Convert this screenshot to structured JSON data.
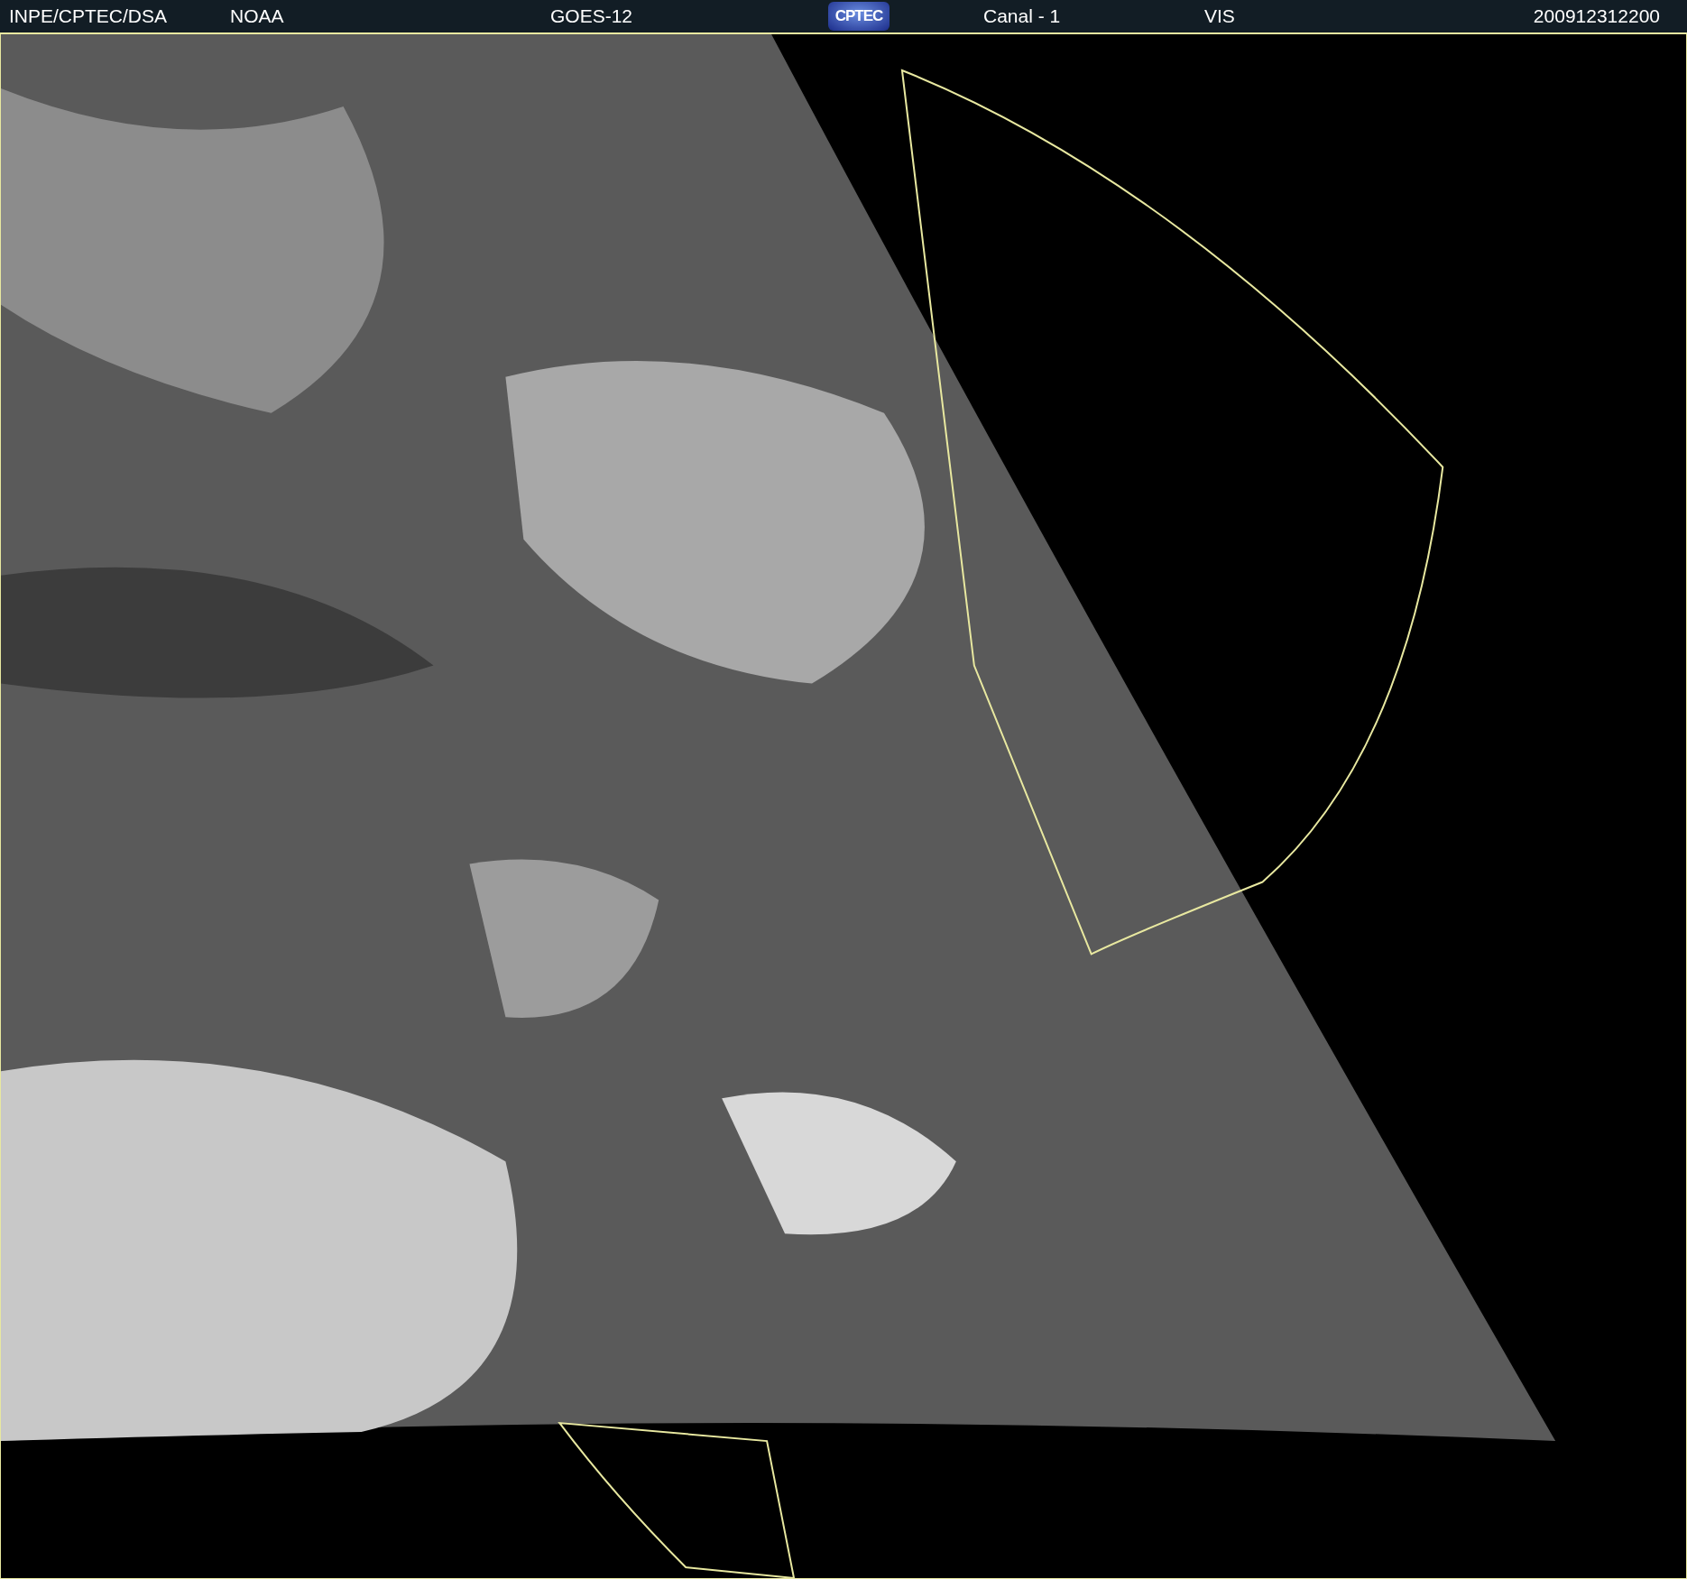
{
  "header": {
    "items": [
      {
        "kind": "text",
        "text": "INPE/CPTEC/DSA"
      },
      {
        "kind": "text",
        "text": "NOAA"
      },
      {
        "kind": "text",
        "text": "GOES-12"
      },
      {
        "kind": "logo",
        "text": "CPTEC"
      },
      {
        "kind": "text",
        "text": "Canal - 1"
      },
      {
        "kind": "text",
        "text": "VIS"
      },
      {
        "kind": "text",
        "text": "200912312200"
      }
    ]
  }
}
